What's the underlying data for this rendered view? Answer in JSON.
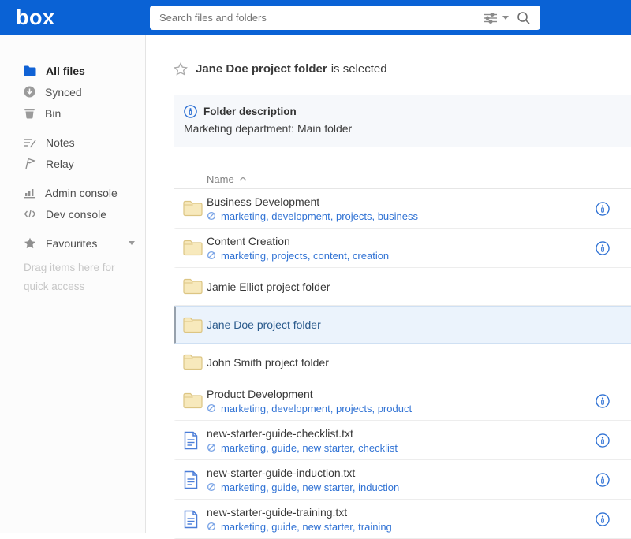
{
  "header": {
    "logo_text": "box",
    "search_placeholder": "Search files and folders"
  },
  "sidebar": {
    "items": [
      {
        "label": "All files",
        "icon": "folder-icon",
        "active": true
      },
      {
        "label": "Synced",
        "icon": "sync-icon"
      },
      {
        "label": "Bin",
        "icon": "trash-icon"
      },
      {
        "label": "Notes",
        "icon": "notes-icon"
      },
      {
        "label": "Relay",
        "icon": "relay-icon"
      },
      {
        "label": "Admin console",
        "icon": "bar-chart-icon"
      },
      {
        "label": "Dev console",
        "icon": "code-icon"
      },
      {
        "label": "Favourites",
        "icon": "star-icon",
        "has_caret": true
      }
    ],
    "drag_hint": "Drag items here for quick access"
  },
  "main": {
    "selection": {
      "title": "Jane Doe project folder",
      "suffix": "is selected"
    },
    "description_panel": {
      "title": "Folder description",
      "text": "Marketing department: Main folder"
    },
    "table": {
      "name_header": "Name",
      "rows": [
        {
          "type": "folder",
          "name": "Business Development",
          "tags": [
            "marketing",
            "development",
            "projects",
            "business"
          ],
          "info": true,
          "selected": false
        },
        {
          "type": "folder",
          "name": "Content Creation",
          "tags": [
            "marketing",
            "projects",
            "content",
            "creation"
          ],
          "info": true,
          "selected": false
        },
        {
          "type": "folder",
          "name": "Jamie Elliot project folder",
          "tags": [],
          "info": false,
          "selected": false
        },
        {
          "type": "folder",
          "name": "Jane Doe project folder",
          "tags": [],
          "info": false,
          "selected": true
        },
        {
          "type": "folder",
          "name": "John Smith project folder",
          "tags": [],
          "info": false,
          "selected": false
        },
        {
          "type": "folder",
          "name": "Product Development",
          "tags": [
            "marketing",
            "development",
            "projects",
            "product"
          ],
          "info": true,
          "selected": false
        },
        {
          "type": "file",
          "name": "new-starter-guide-checklist.txt",
          "tags": [
            "marketing",
            "guide",
            "new starter",
            "checklist"
          ],
          "info": true,
          "selected": false
        },
        {
          "type": "file",
          "name": "new-starter-guide-induction.txt",
          "tags": [
            "marketing",
            "guide",
            "new starter",
            "induction"
          ],
          "info": true,
          "selected": false
        },
        {
          "type": "file",
          "name": "new-starter-guide-training.txt",
          "tags": [
            "marketing",
            "guide",
            "new starter",
            "training"
          ],
          "info": true,
          "selected": false
        }
      ]
    }
  },
  "colors": {
    "brand_blue": "#0A62D5",
    "link_blue": "#3072D4",
    "selected_row_bg": "#EBF3FC",
    "folder_yellow": "#F7E9BC",
    "folder_yellow_border": "#DCC583",
    "file_icon_blue": "#4A7DD8"
  }
}
